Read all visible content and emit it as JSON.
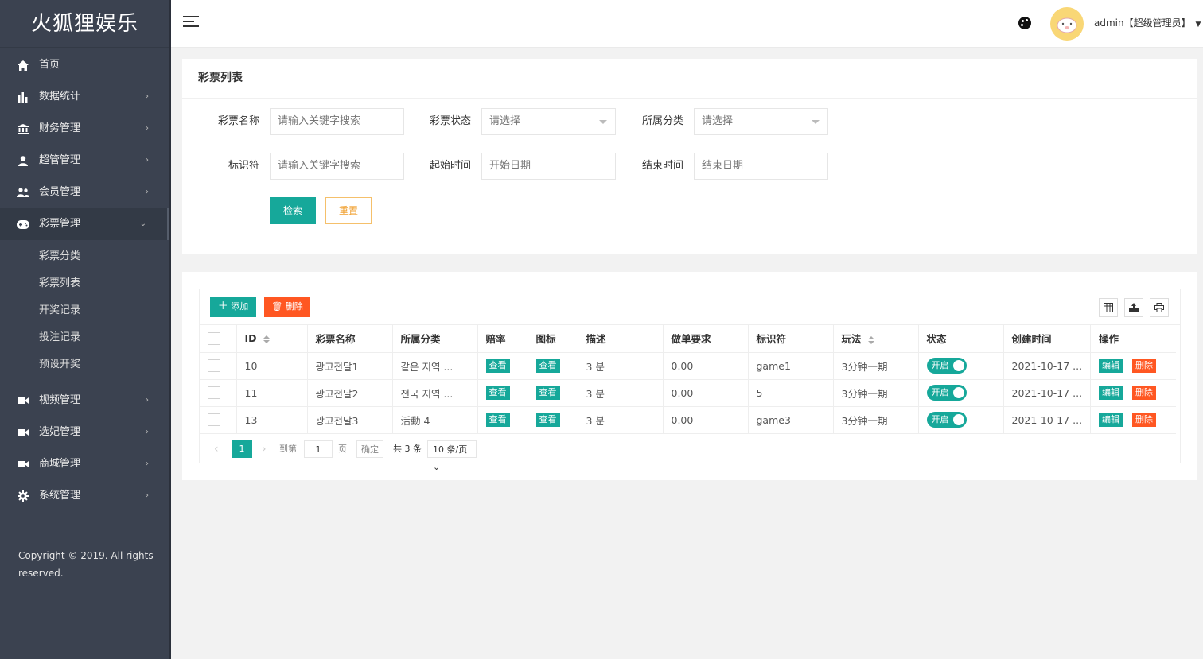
{
  "sidebar": {
    "logo": "火狐狸娱乐",
    "items": [
      {
        "label": "首页",
        "icon": "home-icon"
      },
      {
        "label": "数据统计",
        "icon": "bar-chart-icon"
      },
      {
        "label": "财务管理",
        "icon": "bank-icon"
      },
      {
        "label": "超管管理",
        "icon": "user-icon"
      },
      {
        "label": "会员管理",
        "icon": "users-icon"
      },
      {
        "label": "彩票管理",
        "icon": "gamepad-icon"
      }
    ],
    "subitems": [
      "彩票分类",
      "彩票列表",
      "开奖记录",
      "投注记录",
      "预设开奖"
    ],
    "items2": [
      {
        "label": "视频管理",
        "icon": "video-icon"
      },
      {
        "label": "选妃管理",
        "icon": "video-icon"
      },
      {
        "label": "商城管理",
        "icon": "video-icon"
      },
      {
        "label": "系统管理",
        "icon": "gear-icon"
      }
    ],
    "copyright": "Copyright © 2019. All rights reserved."
  },
  "header": {
    "user": "admin【超级管理员】"
  },
  "search": {
    "title": "彩票列表",
    "fields": {
      "name_label": "彩票名称",
      "name_placeholder": "请输入关键字搜索",
      "status_label": "彩票状态",
      "status_value": "请选择",
      "category_label": "所属分类",
      "category_value": "请选择",
      "key_label": "标识符",
      "key_placeholder": "请输入关键字搜索",
      "start_label": "起始时间",
      "start_placeholder": "开始日期",
      "end_label": "结束时间",
      "end_placeholder": "结束日期"
    },
    "search_button": "检索",
    "reset_button": "重置"
  },
  "table": {
    "add_button": "添加",
    "delete_button": "删除",
    "columns": [
      "ID",
      "彩票名称",
      "所属分类",
      "赔率",
      "图标",
      "描述",
      "做单要求",
      "标识符",
      "玩法",
      "状态",
      "创建时间",
      "操作"
    ],
    "view_label": "查看",
    "edit_label": "编辑",
    "remove_label": "删除",
    "switch_on": "开启",
    "rows": [
      {
        "id": "10",
        "name": "광고전달1",
        "category": "같은 지역 ...",
        "desc": "3 분",
        "requirement": "0.00",
        "key": "game1",
        "play": "3分钟一期",
        "created": "2021-10-17 ..."
      },
      {
        "id": "11",
        "name": "광고전달2",
        "category": "전국 지역 ...",
        "desc": "3 분",
        "requirement": "0.00",
        "key": "5",
        "play": "3分钟一期",
        "created": "2021-10-17 ..."
      },
      {
        "id": "13",
        "name": "광고전달3",
        "category": "活動 4",
        "desc": "3 분",
        "requirement": "0.00",
        "key": "game3",
        "play": "3分钟一期",
        "created": "2021-10-17 ..."
      }
    ]
  },
  "pager": {
    "current": "1",
    "goto_label": "到第",
    "goto_value": "1",
    "page_label": "页",
    "confirm": "确定",
    "total": "共 3 条",
    "page_size": "10 条/页"
  }
}
